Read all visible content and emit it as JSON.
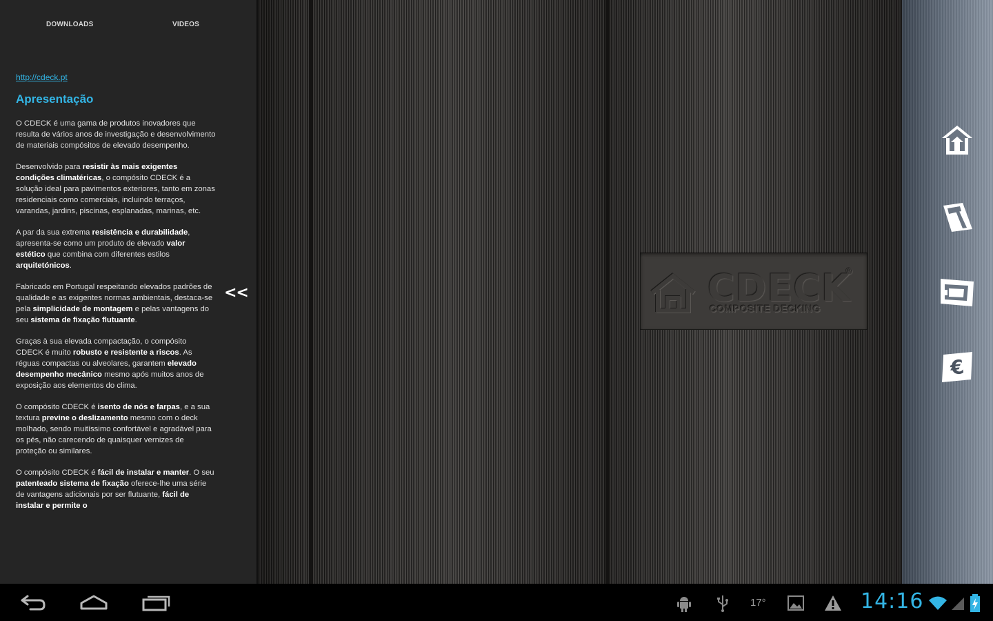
{
  "drawer": {
    "tabs": [
      "DOWNLOADS",
      "VIDEOS"
    ],
    "link": "http://cdeck.pt",
    "title": "Apresentação",
    "collapse_label": "<<",
    "paragraphs": [
      [
        {
          "t": "O CDECK é uma gama de produtos inovadores que resulta de vários anos de investigação e desenvolvimento de materiais compósitos de elevado desempenho.",
          "b": false
        }
      ],
      [
        {
          "t": "Desenvolvido para ",
          "b": false
        },
        {
          "t": "resistir às mais exigentes condições climatéricas",
          "b": true
        },
        {
          "t": ", o compósito CDECK é a solução ideal para pavimentos exteriores, tanto em zonas residenciais como comerciais, incluindo terraços, varandas, jardins, piscinas, esplanadas, marinas, etc.",
          "b": false
        }
      ],
      [
        {
          "t": "A par da sua extrema ",
          "b": false
        },
        {
          "t": "resistência e durabilidade",
          "b": true
        },
        {
          "t": ", apresenta-se como um produto de elevado ",
          "b": false
        },
        {
          "t": "valor estético",
          "b": true
        },
        {
          "t": " que combina com diferentes estilos ",
          "b": false
        },
        {
          "t": "arquitetónicos",
          "b": true
        },
        {
          "t": ".",
          "b": false
        }
      ],
      [
        {
          "t": "Fabricado em Portugal respeitando elevados padrões de qualidade e as exigentes normas ambientais, destaca-se pela ",
          "b": false
        },
        {
          "t": "simplicidade de montagem",
          "b": true
        },
        {
          "t": " e pelas vantagens do seu ",
          "b": false
        },
        {
          "t": "sistema de fixação flutuante",
          "b": true
        },
        {
          "t": ".",
          "b": false
        }
      ],
      [
        {
          "t": "Graças à sua elevada compactação, o compósito CDECK é muito ",
          "b": false
        },
        {
          "t": "robusto e resistente a riscos",
          "b": true
        },
        {
          "t": ". As réguas compactas ou alveolares, garantem ",
          "b": false
        },
        {
          "t": "elevado desempenho mecânico",
          "b": true
        },
        {
          "t": " mesmo após muitos anos de exposição aos elementos do clima.",
          "b": false
        }
      ],
      [
        {
          "t": "O compósito CDECK é ",
          "b": false
        },
        {
          "t": "isento de nós e farpas",
          "b": true
        },
        {
          "t": ", e a sua textura ",
          "b": false
        },
        {
          "t": "previne o deslizamento",
          "b": true
        },
        {
          "t": " mesmo com o deck molhado, sendo muitíssimo confortável e agradável para os pés, não carecendo de quaisquer vernizes de proteção ou similares.",
          "b": false
        }
      ],
      [
        {
          "t": "O compósito CDECK é ",
          "b": false
        },
        {
          "t": "fácil de instalar e manter",
          "b": true
        },
        {
          "t": ". O seu ",
          "b": false
        },
        {
          "t": "patenteado sistema de fixação",
          "b": true
        },
        {
          "t": " oferece-lhe uma série de vantagens adicionais por ser flutuante, ",
          "b": false
        },
        {
          "t": "fácil de instalar e permite o",
          "b": true
        }
      ]
    ]
  },
  "logo": {
    "word": "CDECK",
    "reg": "®",
    "subtitle": "COMPOSITE DECKING"
  },
  "sidebar": {
    "icons": [
      "home-icon",
      "measure-icon",
      "profile-icon",
      "euro-icon"
    ]
  },
  "statusbar": {
    "temperature": "17°",
    "time": "14:16",
    "accent": "#33b5e5"
  }
}
